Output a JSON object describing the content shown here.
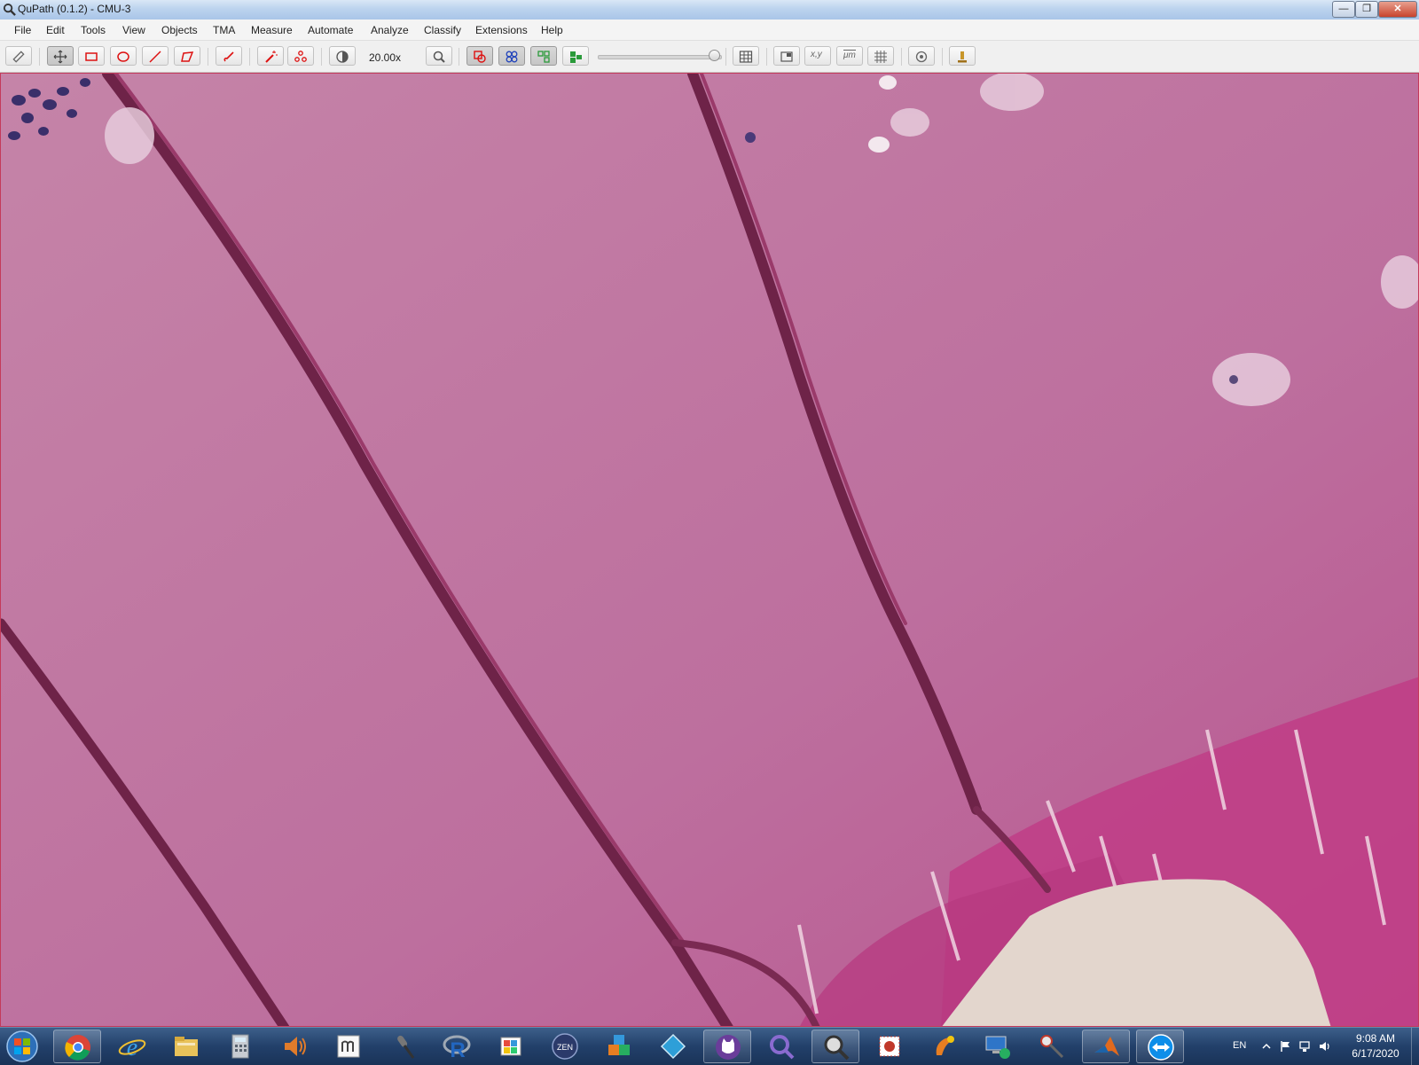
{
  "window": {
    "title": "QuPath (0.1.2) - CMU-3",
    "controls": [
      "minimize-icon",
      "maximize-icon",
      "close-icon"
    ]
  },
  "menu": [
    "File",
    "Edit",
    "Tools",
    "View",
    "Objects",
    "TMA",
    "Measure",
    "Automate",
    "Analyze",
    "Classify",
    "Extensions",
    "Help"
  ],
  "toolbar": {
    "magnification": "20.00x",
    "opacity_slider": 1.0,
    "coord_label": "x,y",
    "scale_label": "μm",
    "tools": [
      "measure-tool-icon",
      "move-tool-icon",
      "rectangle-tool-icon",
      "ellipse-tool-icon",
      "line-tool-icon",
      "polygon-tool-icon",
      "brush-tool-icon",
      "wand-tool-icon",
      "points-tool-icon",
      "brightness-contrast-icon",
      "zoom-to-fit-icon",
      "show-annotations-icon",
      "show-tma-grid-icon",
      "show-detections-icon",
      "fill-detections-icon",
      "measurement-table-icon",
      "overview-icon",
      "cursor-location-icon",
      "scalebar-icon",
      "grid-icon",
      "preferences-icon",
      "log-icon"
    ]
  },
  "viewer": {
    "image": "CMU-3",
    "stain_colors": {
      "background": "#c07aa0",
      "edge": "#d2408a",
      "fiber": "#6e2348",
      "nuclei": "#3a2f6a",
      "lumen": "#e3d6cd"
    }
  },
  "taskbar": {
    "apps": [
      "start-orb-icon",
      "chrome-icon",
      "internet-explorer-icon",
      "file-explorer-icon",
      "calculator-icon",
      "speaker-icon",
      "text-editor-icon",
      "microphone-icon",
      "r-icon",
      "paint-icon",
      "zen-icon",
      "cube-icon",
      "prism-icon",
      "cat-app-icon",
      "search-app-icon",
      "qupath-icon",
      "stamp-icon",
      "onenote-icon",
      "remote-desktop-icon",
      "snipping-icon",
      "matlab-icon",
      "teamviewer-icon"
    ],
    "zen_label": "ZEN",
    "r_label": "R",
    "language": "EN",
    "time": "9:08 AM",
    "date": "6/17/2020"
  }
}
